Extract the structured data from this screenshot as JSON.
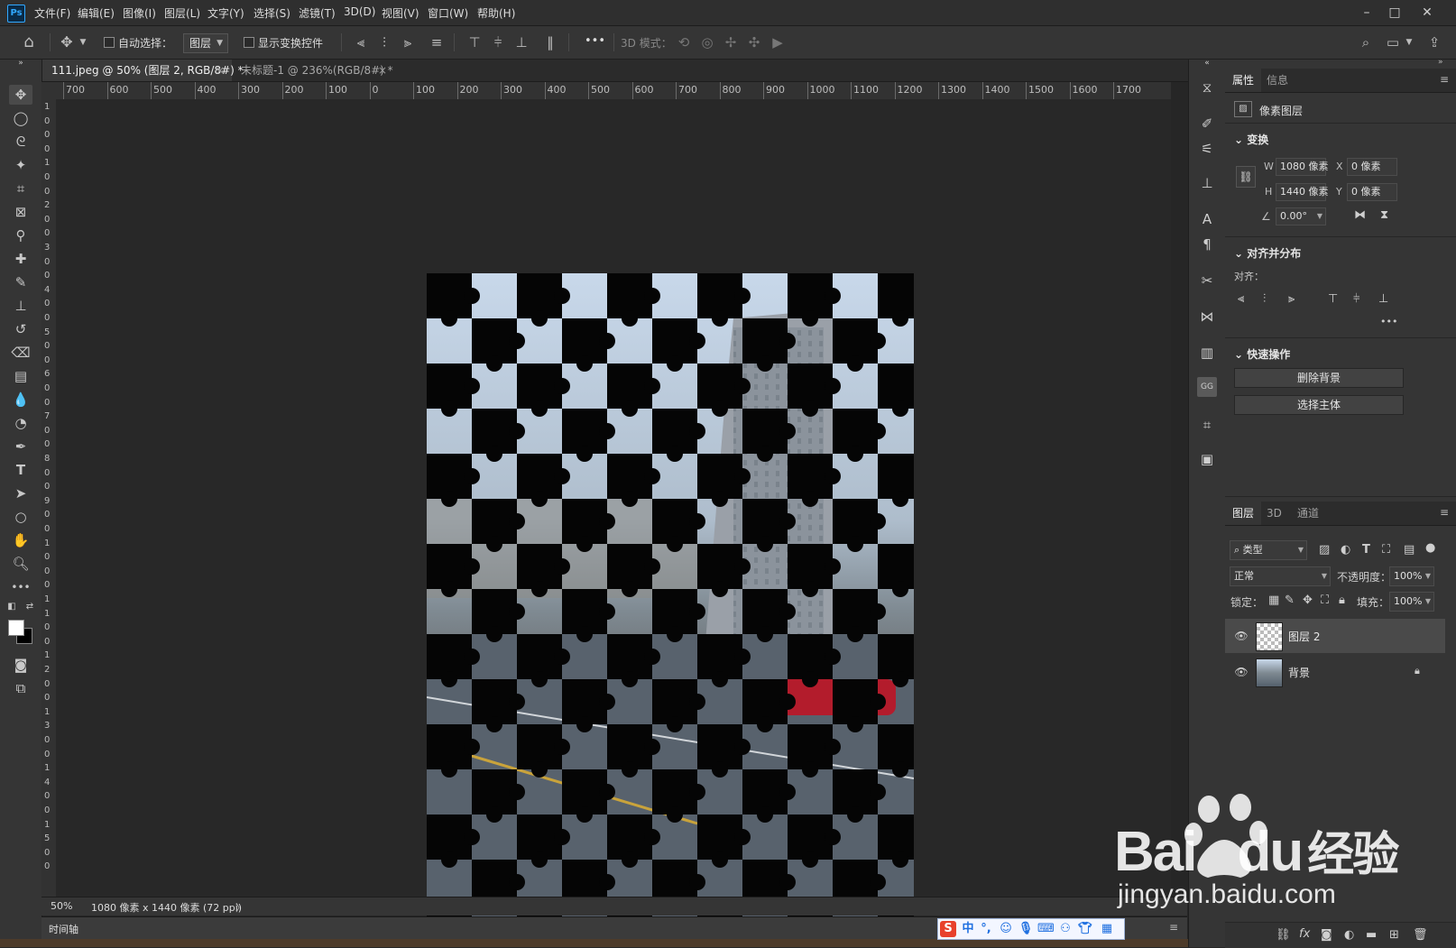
{
  "app": {
    "logo": "Ps"
  },
  "menu": [
    "文件(F)",
    "编辑(E)",
    "图像(I)",
    "图层(L)",
    "文字(Y)",
    "选择(S)",
    "滤镜(T)",
    "3D(D)",
    "视图(V)",
    "窗口(W)",
    "帮助(H)"
  ],
  "window_controls": {
    "minimize": "–",
    "maximize": "□",
    "close": "✕"
  },
  "options": {
    "auto_select_label": "自动选择：",
    "auto_select_target": "图层",
    "show_transform_label": "显示变换控件",
    "mode_3d_label": "3D 模式：",
    "more": "•••"
  },
  "tabs": [
    {
      "title": "111.jpeg @ 50% (图层 2, RGB/8#) *",
      "active": true
    },
    {
      "title": "未标题-1 @ 236%(RGB/8#) *",
      "active": false
    }
  ],
  "ruler_h": [
    "700",
    "600",
    "500",
    "400",
    "300",
    "200",
    "100",
    "0",
    "100",
    "200",
    "300",
    "400",
    "500",
    "600",
    "700",
    "800",
    "900",
    "1000",
    "1100",
    "1200",
    "1300",
    "1400",
    "1500",
    "1600",
    "1700"
  ],
  "ruler_v": [
    "1",
    "0",
    "0",
    "0",
    "1",
    "0",
    "0",
    "2",
    "0",
    "0",
    "3",
    "0",
    "0",
    "4",
    "0",
    "0",
    "5",
    "0",
    "0",
    "6",
    "0",
    "0",
    "7",
    "0",
    "0",
    "8",
    "0",
    "0",
    "9",
    "0",
    "0",
    "1",
    "0",
    "0",
    "0",
    "1",
    "1",
    "0",
    "0",
    "1",
    "2",
    "0",
    "0",
    "1",
    "3",
    "0",
    "0",
    "1",
    "4",
    "0",
    "0",
    "1",
    "5",
    "0",
    "0"
  ],
  "status": {
    "zoom": "50%",
    "doc_info": "1080 像素 x 1440 像素 (72 ppi)",
    "arrow": "〉"
  },
  "timeline_label": "时间轴",
  "properties": {
    "tab_properties": "属性",
    "tab_info": "信息",
    "layer_type": "像素图层",
    "transform_title": "变换",
    "w_label": "W",
    "w_value": "1080 像素",
    "h_label": "H",
    "h_value": "1440 像素",
    "x_label": "X",
    "x_value": "0 像素",
    "y_label": "Y",
    "y_value": "0 像素",
    "angle_value": "0.00°",
    "align_title": "对齐并分布",
    "align_label": "对齐：",
    "more": "•••",
    "quick_title": "快速操作",
    "btn_remove_bg": "删除背景",
    "btn_select_subject": "选择主体"
  },
  "layers_panel": {
    "tab_layers": "图层",
    "tab_3d": "3D",
    "tab_channels": "通道",
    "filter_kind": "类型",
    "blend_mode": "正常",
    "opacity_label": "不透明度：",
    "opacity_value": "100%",
    "lock_label": "锁定：",
    "fill_label": "填充：",
    "fill_value": "100%",
    "layers": [
      {
        "name": "图层 2",
        "selected": true
      },
      {
        "name": "背景",
        "selected": false
      }
    ]
  },
  "ime": {
    "lang": "中"
  },
  "watermark": {
    "brand": "Bai",
    "brand2": "du",
    "cn": "经验",
    "url": "jingyan.baidu.com"
  },
  "colors": {
    "accent": "#31a8ff",
    "panel": "#353535",
    "canvas_bg": "#282828",
    "selected_layer": "#4a4a4a"
  }
}
